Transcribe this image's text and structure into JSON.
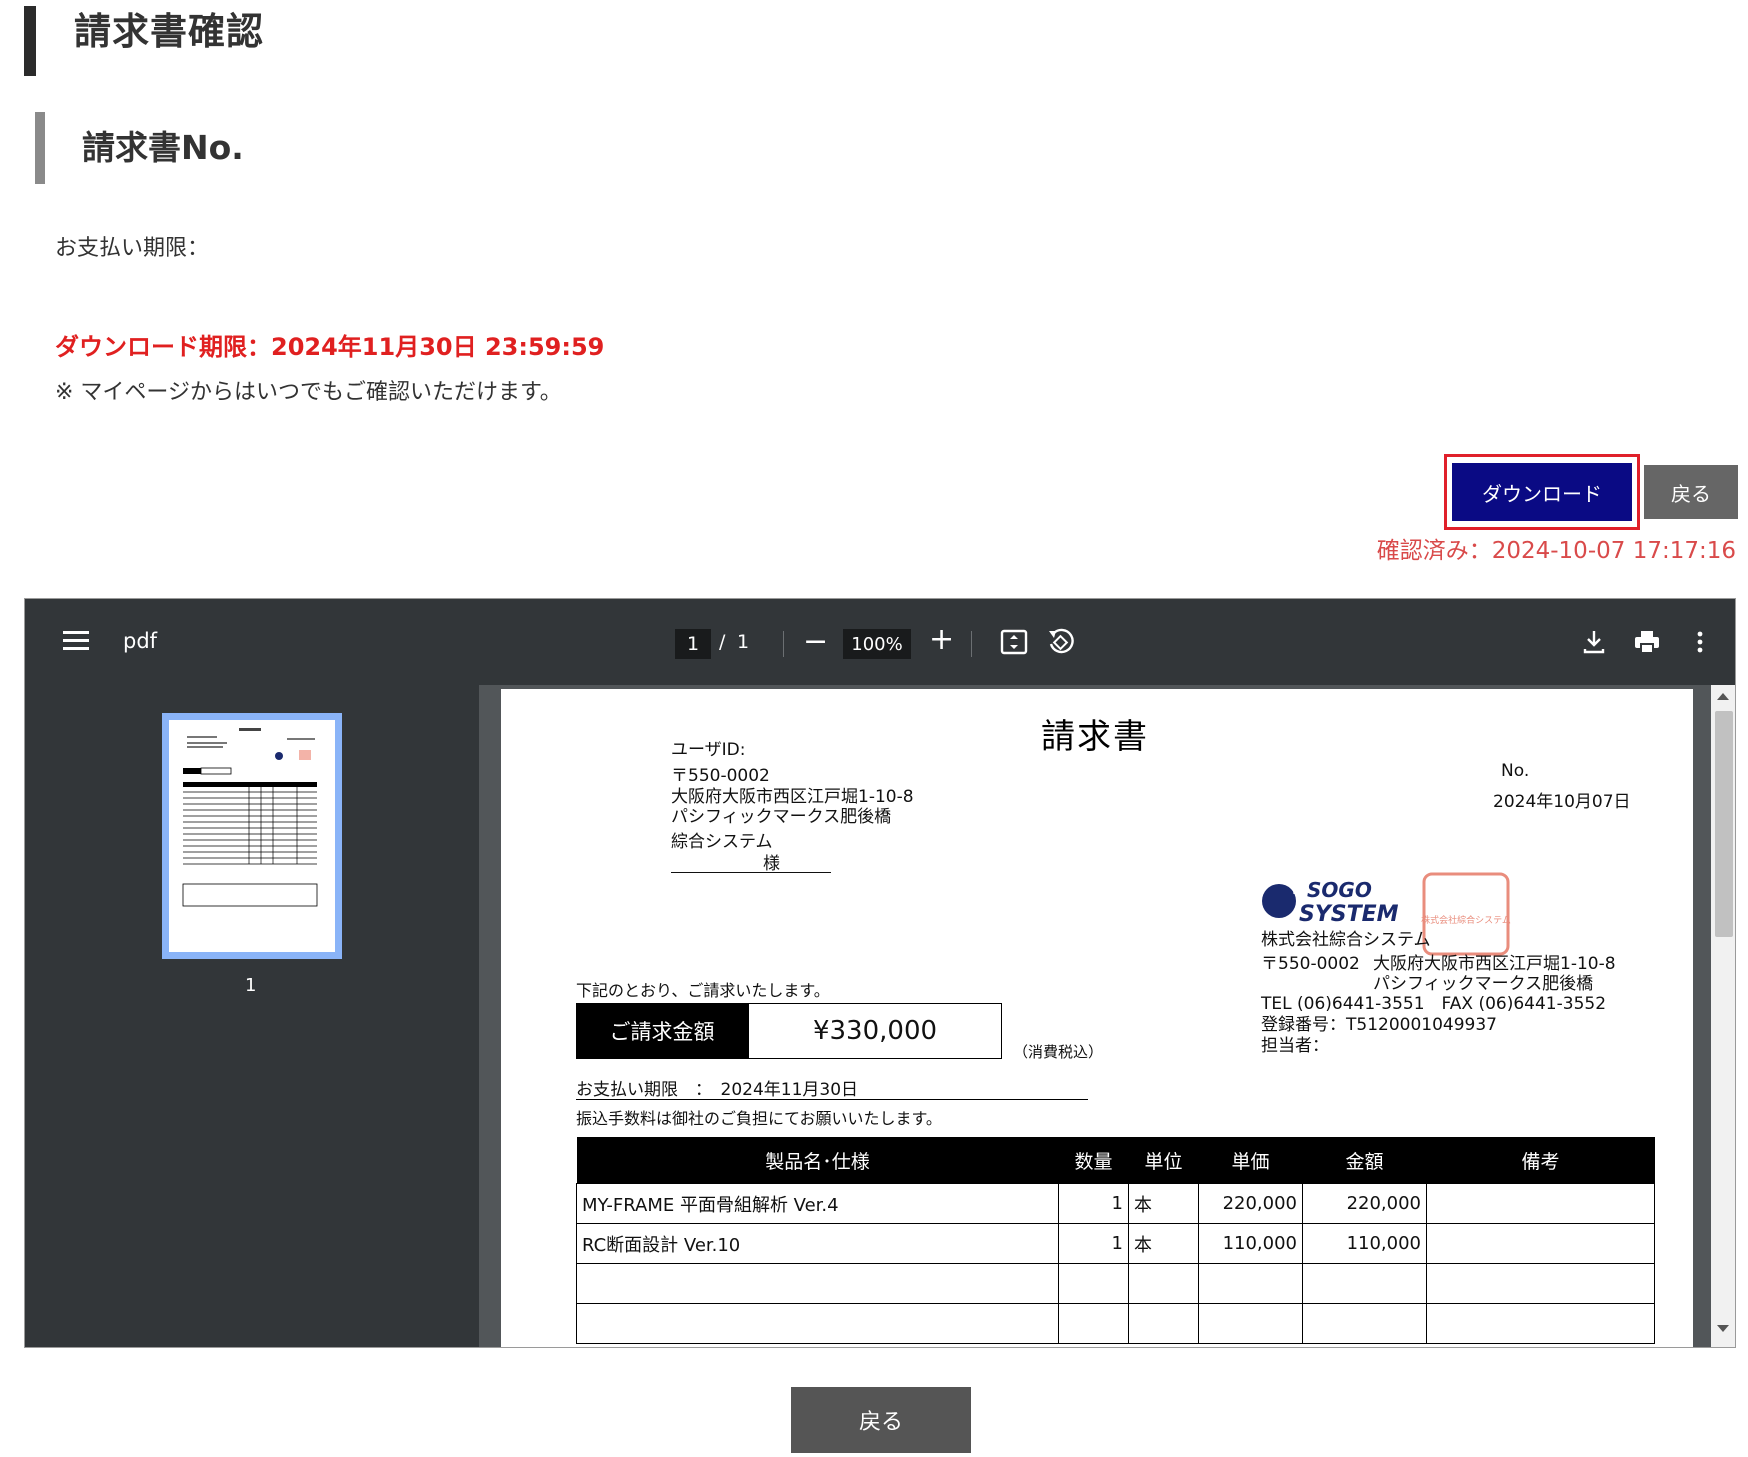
{
  "header": {
    "title": "請求書確認",
    "subtitle": "請求書No."
  },
  "payment_deadline_label": "お支払い期限：",
  "download_deadline": "ダウンロード期限：2024年11月30日 23:59:59",
  "note": "※ マイページからはいつでもご確認いただけます。",
  "actions": {
    "download_label": "ダウンロード",
    "back_label": "戻る",
    "confirmed": "確認済み：2024-10-07 17:17:16"
  },
  "viewer": {
    "title": "pdf",
    "page_current": "1",
    "page_sep": "/",
    "page_total": "1",
    "zoom": "100%",
    "thumb_label": "1",
    "colors": {
      "toolbar": "#323639",
      "canvas": "#525659",
      "thumb_border": "#8ab4f8"
    }
  },
  "invoice": {
    "title": "請求書",
    "user_id_label": "ユーザID:",
    "postal": "〒550-0002",
    "addr1": "大阪府大阪市西区江戸堀1-10-8",
    "addr2": "パシフィックマークス肥後橋",
    "company_to": "綜合システム",
    "sama": "様",
    "no_label": "No.",
    "date": "2024年10月07日",
    "logo_line1": "SOGO",
    "logo_line2": "SYSTEM",
    "seal_text": "株式会社綜合システム",
    "company": "株式会社綜合システム",
    "company_postal": "〒550-0002",
    "company_addr1": "大阪府大阪市西区江戸堀1-10-8",
    "company_addr2": "パシフィックマークス肥後橋",
    "tel_fax": "TEL (06)6441-3551　FAX (06)6441-3552",
    "reg_no": "登録番号：T5120001049937",
    "person": "担当者：",
    "intro": "下記のとおり、ご請求いたします。",
    "amount_label": "ご請求金額",
    "amount": "¥330,000",
    "tax_note": "（消費税込）",
    "due": "お支払い期限　：　2024年11月30日",
    "fee_note": "振込手数料は御社のご負担にてお願いいたします。",
    "columns": [
      "製品名･仕様",
      "数量",
      "単位",
      "単価",
      "金額",
      "備考"
    ],
    "rows": [
      [
        "MY-FRAME 平面骨組解析 Ver.4",
        "1",
        "本",
        "220,000",
        "220,000",
        ""
      ],
      [
        "RC断面設計 Ver.10",
        "1",
        "本",
        "110,000",
        "110,000",
        ""
      ],
      [
        "",
        "",
        "",
        "",
        "",
        ""
      ],
      [
        "",
        "",
        "",
        "",
        "",
        ""
      ]
    ]
  },
  "bottom": {
    "back_label": "戻る"
  }
}
